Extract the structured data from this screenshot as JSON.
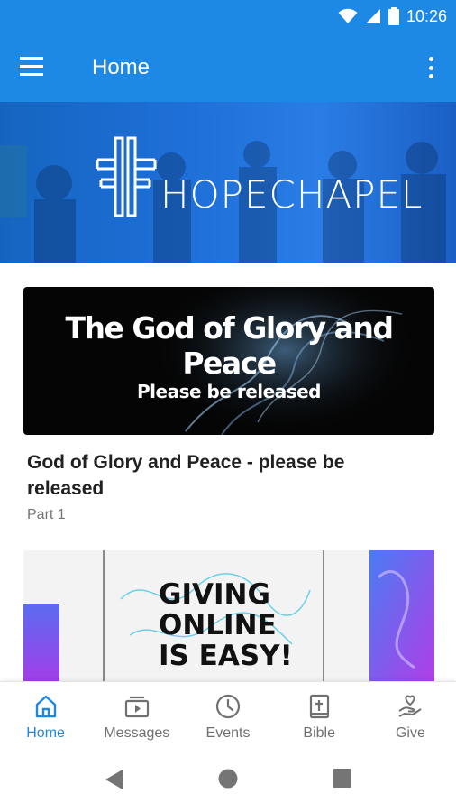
{
  "status_bar": {
    "time": "10:26"
  },
  "app_bar": {
    "title": "Home"
  },
  "hero": {
    "logo_text": "HOPECHAPEL"
  },
  "featured": {
    "banner_title": "The God of Glory and Peace",
    "banner_subtitle": "Please be released",
    "title": "God of Glory and Peace - please be released",
    "subtitle": "Part 1"
  },
  "promo": {
    "lines": [
      "GIVING",
      "ONLINE",
      "IS EASY!"
    ]
  },
  "bottom_nav": {
    "items": [
      {
        "label": "Home",
        "icon": "home-icon",
        "active": true
      },
      {
        "label": "Messages",
        "icon": "messages-icon",
        "active": false
      },
      {
        "label": "Events",
        "icon": "clock-icon",
        "active": false
      },
      {
        "label": "Bible",
        "icon": "bible-icon",
        "active": false
      },
      {
        "label": "Give",
        "icon": "give-icon",
        "active": false
      }
    ]
  },
  "colors": {
    "primary": "#1e88e5",
    "inactive": "#707070",
    "text_dark": "#212121",
    "text_muted": "#757575"
  }
}
